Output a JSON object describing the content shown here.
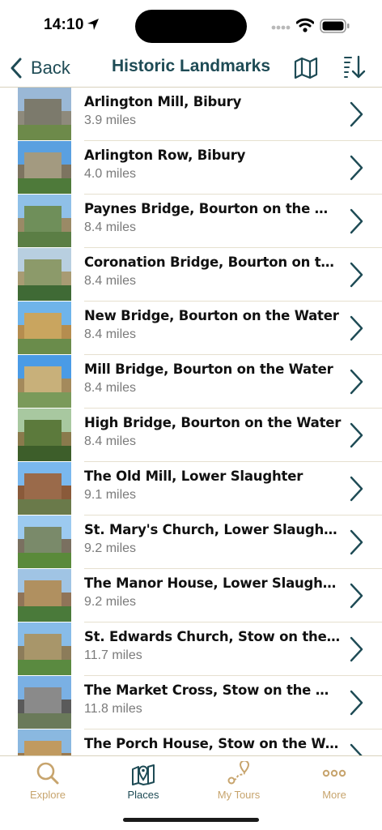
{
  "status_bar": {
    "time": "14:10"
  },
  "nav": {
    "back_label": "Back",
    "title": "Historic Landmarks",
    "accent_color": "#1e4b55"
  },
  "landmarks": [
    {
      "name": "Arlington Mill, Bibury",
      "distance": "3.9 miles"
    },
    {
      "name": "Arlington Row, Bibury",
      "distance": "4.0 miles"
    },
    {
      "name": "Paynes Bridge, Bourton on the Water",
      "distance": "8.4 miles"
    },
    {
      "name": "Coronation Bridge, Bourton on the...",
      "distance": "8.4 miles"
    },
    {
      "name": "New Bridge, Bourton on the Water",
      "distance": "8.4 miles"
    },
    {
      "name": "Mill Bridge, Bourton on the Water",
      "distance": "8.4 miles"
    },
    {
      "name": "High Bridge, Bourton on the Water",
      "distance": "8.4 miles"
    },
    {
      "name": "The Old Mill, Lower Slaughter",
      "distance": "9.1 miles"
    },
    {
      "name": "St. Mary's Church, Lower Slaughter",
      "distance": "9.2 miles"
    },
    {
      "name": "The Manor House, Lower Slaughter",
      "distance": "9.2 miles"
    },
    {
      "name": "St. Edwards Church, Stow on the Wold",
      "distance": "11.7 miles"
    },
    {
      "name": "The Market Cross, Stow on the Wold",
      "distance": "11.8 miles"
    },
    {
      "name": "The Porch House, Stow on the Wold",
      "distance": ""
    }
  ],
  "tabs": [
    {
      "label": "Explore",
      "icon": "search-icon",
      "active": false
    },
    {
      "label": "Places",
      "icon": "map-pin-icon",
      "active": true
    },
    {
      "label": "My Tours",
      "icon": "route-icon",
      "active": false
    },
    {
      "label": "More",
      "icon": "more-icon",
      "active": false
    }
  ],
  "colors": {
    "inactive_tab": "#c7a46d",
    "active_tab": "#1e4b55"
  }
}
